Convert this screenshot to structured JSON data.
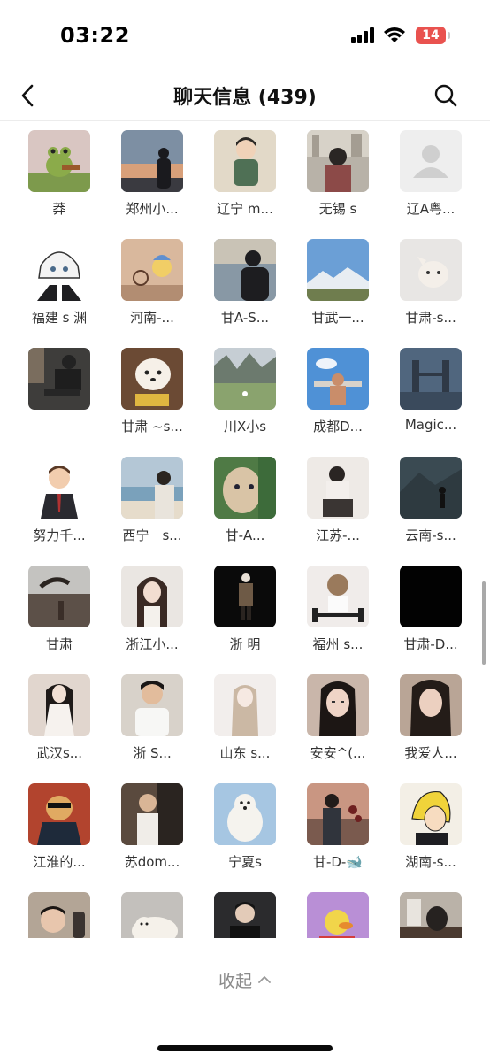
{
  "status_bar": {
    "time": "03:22",
    "battery": "14",
    "battery_color": "#e9524f"
  },
  "nav": {
    "title": "聊天信息 (439)",
    "back_icon": "chevron-left-icon",
    "search_icon": "search-icon"
  },
  "members": [
    {
      "name": "莽",
      "avatar": "frog-guitar"
    },
    {
      "name": "郑州小...",
      "avatar": "sunset-silhouette"
    },
    {
      "name": "辽宁 m...",
      "avatar": "anime-boy-green"
    },
    {
      "name": "无锡 s",
      "avatar": "city-selfie"
    },
    {
      "name": "辽A粤...",
      "avatar": "default-avatar"
    },
    {
      "name": "福建 s 渊",
      "avatar": "anime-white-hair"
    },
    {
      "name": "河南-...",
      "avatar": "cart-chick"
    },
    {
      "name": "甘A-S...",
      "avatar": "cap-sea"
    },
    {
      "name": "甘武一...",
      "avatar": "snow-mountain"
    },
    {
      "name": "甘肃-s...",
      "avatar": "meme-cat"
    },
    {
      "name": "",
      "avatar": "dark-couch"
    },
    {
      "name": "甘肃 ~s...",
      "avatar": "samoyed-dog"
    },
    {
      "name": "川X小s",
      "avatar": "mountain-valley"
    },
    {
      "name": "成都D...",
      "avatar": "gym-sky"
    },
    {
      "name": "Magic...",
      "avatar": "tower-bridge"
    },
    {
      "name": "努力千...",
      "avatar": "cartoon-suit"
    },
    {
      "name": "西宁　s...",
      "avatar": "beach-man"
    },
    {
      "name": "甘-A...",
      "avatar": "green-face"
    },
    {
      "name": "江苏-...",
      "avatar": "mirror-selfie"
    },
    {
      "name": "云南-s...",
      "avatar": "volcano-figure"
    },
    {
      "name": "甘肃",
      "avatar": "underwater-hand"
    },
    {
      "name": "浙江小...",
      "avatar": "girl-long-hair"
    },
    {
      "name": "浙 明",
      "avatar": "dark-figure"
    },
    {
      "name": "福州 s...",
      "avatar": "cat-barbell"
    },
    {
      "name": "甘肃-D...",
      "avatar": "black-square"
    },
    {
      "name": "武汉s...",
      "avatar": "girl-white-dress"
    },
    {
      "name": "浙 S...",
      "avatar": "boy-white-shirt"
    },
    {
      "name": "山东 s...",
      "avatar": "pale-girl"
    },
    {
      "name": "安安^(...",
      "avatar": "woman-portrait"
    },
    {
      "name": "我爱人...",
      "avatar": "woman-portrait-2"
    },
    {
      "name": "江淮的...",
      "avatar": "doge-suit"
    },
    {
      "name": "苏dom...",
      "avatar": "man-tank-top"
    },
    {
      "name": "宁夏s",
      "avatar": "polar-bear"
    },
    {
      "name": "甘-D-🐋",
      "avatar": "man-roses"
    },
    {
      "name": "湖南-s...",
      "avatar": "anime-sanji"
    },
    {
      "name": "",
      "avatar": "smiling-man"
    },
    {
      "name": "",
      "avatar": "white-cat"
    },
    {
      "name": "",
      "avatar": "man-black"
    },
    {
      "name": "",
      "avatar": "cartoon-duck"
    },
    {
      "name": "",
      "avatar": "cat-dark"
    }
  ],
  "collapse": {
    "label": "收起",
    "icon": "chevron-up-icon"
  }
}
